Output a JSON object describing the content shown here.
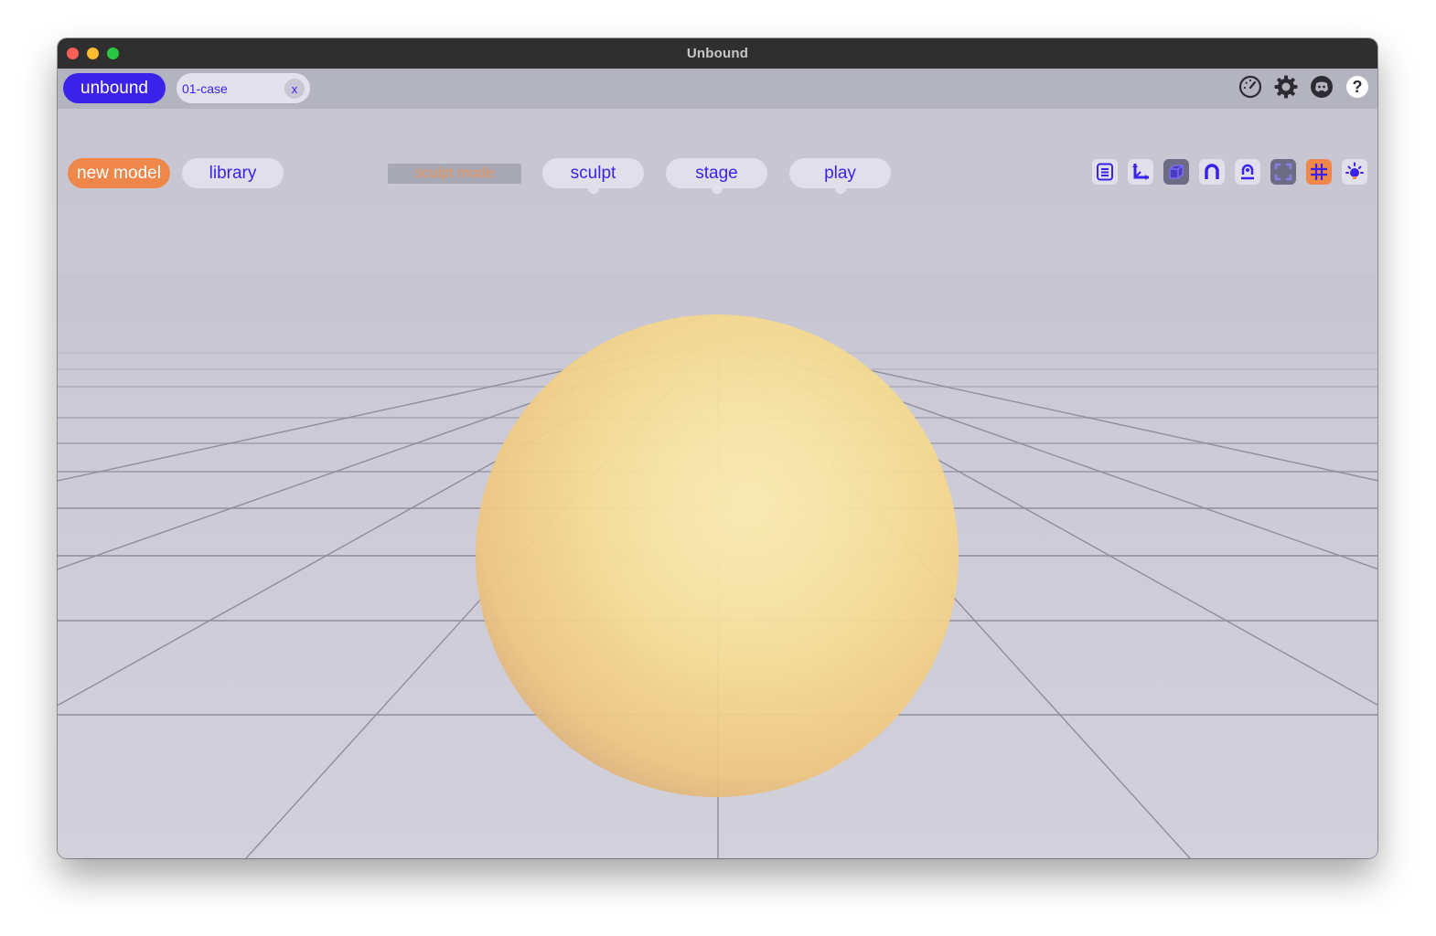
{
  "window": {
    "title": "Unbound"
  },
  "topbar": {
    "brand_label": "unbound",
    "doc_tab": {
      "name": "01-case",
      "close_label": "x"
    },
    "icons": [
      "performance-icon",
      "settings-gear-icon",
      "discord-icon",
      "help-icon"
    ]
  },
  "toolbar": {
    "new_model_label": "new model",
    "library_label": "library",
    "mode_label": "sculpt mode",
    "modes": [
      {
        "label": "sculpt"
      },
      {
        "label": "stage"
      },
      {
        "label": "play"
      }
    ],
    "tools": [
      "list-icon",
      "axes-icon",
      "cube-icon",
      "magnet-icon",
      "person-icon",
      "frame-icon",
      "grid-icon",
      "light-icon"
    ]
  },
  "colors": {
    "accent": "#3b22ea",
    "orange": "#f0874a",
    "sphere": "#f6dc95",
    "background": "#cdccd8"
  }
}
